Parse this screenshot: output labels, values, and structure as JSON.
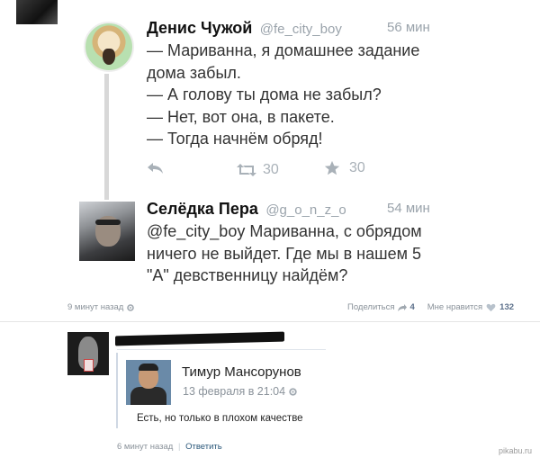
{
  "tweet1": {
    "name": "Денис Чужой",
    "handle": "@fe_city_boy",
    "time": "56 мин",
    "lines": [
      "— Мариванна, я домашнее задание",
      "дома забыл.",
      "— А голову ты дома не забыл?",
      "— Нет, вот она, в пакете.",
      "— Тогда начнём обряд!"
    ],
    "retweets": "30",
    "favorites": "30"
  },
  "tweet2": {
    "name": "Селёдка Пера",
    "handle": "@g_o_n_z_o",
    "time": "54 мин",
    "lines": [
      "@fe_city_boy Мариванна, с обрядом",
      "ничего не выйдет. Где мы в нашем 5",
      "\"А\" девственницу найдём?"
    ]
  },
  "post_meta": {
    "posted": "9 минут назад",
    "share_label": "Поделиться",
    "share_count": "4",
    "like_label": "Мне нравится",
    "like_count": "132"
  },
  "comment": {
    "reply_name": "Тимур Мансорунов",
    "reply_date": "13 февраля в 21:04",
    "reply_text": "Есть, но только в плохом качестве",
    "posted": "6 минут назад",
    "separator": "|",
    "reply_link": "Ответить"
  },
  "watermark": "pikabu.ru",
  "icons": [
    "reply-icon",
    "retweet-icon",
    "star-icon",
    "gear-icon",
    "share-icon",
    "heart-icon"
  ]
}
